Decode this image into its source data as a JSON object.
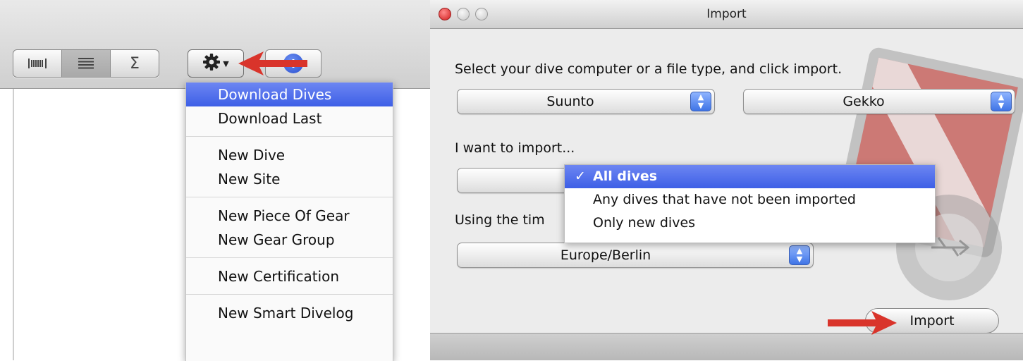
{
  "left_panel": {
    "toolbar": {
      "view_buttons": [
        {
          "name": "barcode-view-icon",
          "glyph": "||||"
        },
        {
          "name": "list-view-icon",
          "glyph": "≡"
        },
        {
          "name": "summary-view-icon",
          "glyph": "Σ"
        }
      ],
      "gear_icon": "gear-icon",
      "info_icon": "info-icon"
    },
    "action_menu": {
      "groups": [
        [
          "Download Dives",
          "Download Last"
        ],
        [
          "New Dive",
          "New Site"
        ],
        [
          "New Piece Of Gear",
          "New Gear Group"
        ],
        [
          "New Certification"
        ],
        [
          "New Smart Divelog"
        ]
      ],
      "selected": "Download Dives"
    }
  },
  "import_window": {
    "title": "Import",
    "prompt": "Select your dive computer or a file type, and click import.",
    "manufacturer_value": "Suunto",
    "model_value": "Gekko",
    "import_label": "I want to import...",
    "import_options": [
      {
        "label": "All dives",
        "selected": true
      },
      {
        "label": "Any dives that have not been imported",
        "selected": false
      },
      {
        "label": "Only new dives",
        "selected": false
      }
    ],
    "check_glyph": "✓",
    "timezone_label": "Using the tim",
    "timezone_value": "Europe/Berlin",
    "import_button": "Import"
  },
  "colors": {
    "selection": "#3d5fe6",
    "annotation_arrow": "#d9342b",
    "close_button": "#d11d1d"
  }
}
